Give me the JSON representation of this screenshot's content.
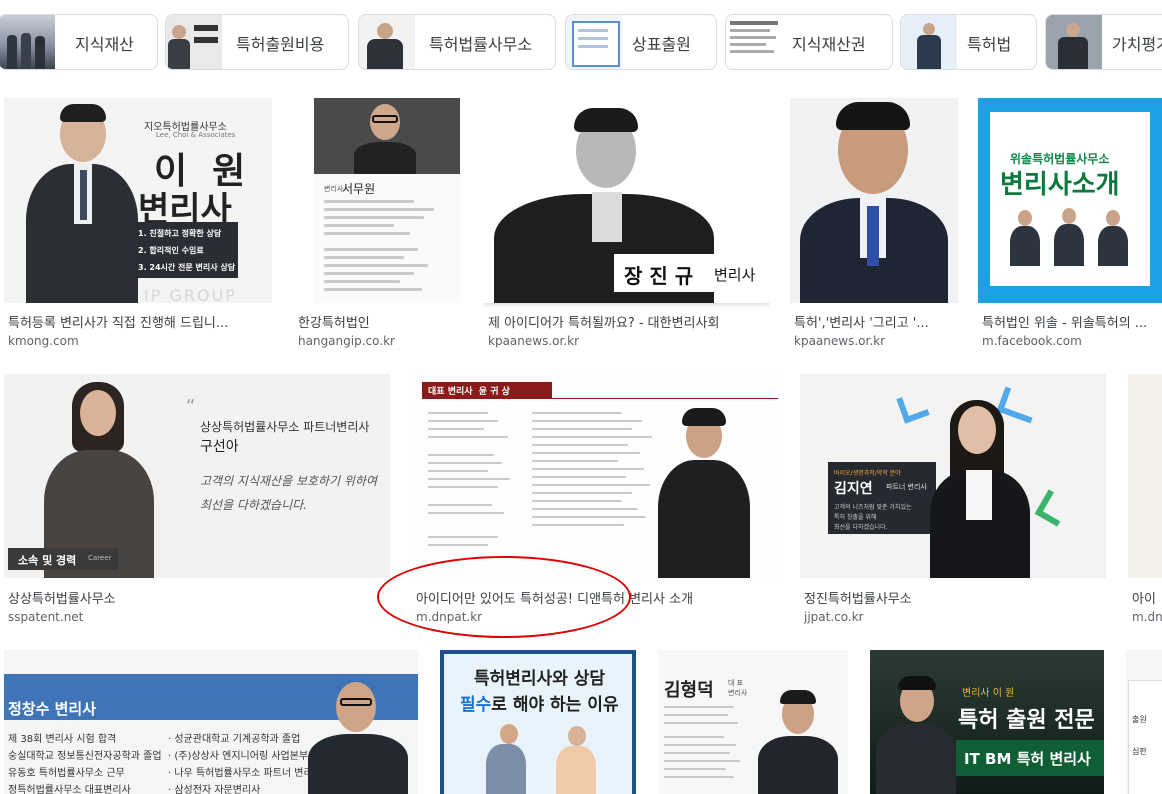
{
  "chips": [
    {
      "label": "지식재산"
    },
    {
      "label": "특허출원비용"
    },
    {
      "label": "특허법률사무소"
    },
    {
      "label": "상표출원"
    },
    {
      "label": "지식재산권"
    },
    {
      "label": "특허법"
    },
    {
      "label": "가치평가"
    }
  ],
  "row1": [
    {
      "title": "특허등록 변리사가 직접 진행해 드립니...",
      "source": "kmong.com",
      "img": {
        "logo": "지오특허법률사무소",
        "logo_sub": "Lee, Choi & Associates",
        "big1": "이  원",
        "big2": "변리사",
        "bullets": [
          "1. 친절하고 정확한 상담",
          "2. 합리적인 수임료",
          "3. 24시간 전문 변리사 상담"
        ],
        "footer": "IP GROUP"
      }
    },
    {
      "title": "한강특허법인",
      "source": "hangangip.co.kr",
      "img": {
        "role": "변리사",
        "name": "서무원"
      }
    },
    {
      "title": "제 아이디어가 특허될까요? - 대한변리사회",
      "source": "kpaanews.or.kr",
      "img": {
        "caption_name": "장 진 규",
        "caption_role": "변리사"
      }
    },
    {
      "title": "특허','변리사 '그리고 '...",
      "source": "kpaanews.or.kr",
      "img": {}
    },
    {
      "title": "특허법인 위솔 - 위솔특허의 ...",
      "source": "m.facebook.com",
      "img": {
        "top": "위솔특허법률사무소",
        "main": "변리사소개"
      }
    }
  ],
  "row2": [
    {
      "title": "상상특허법률사무소",
      "source": "sspatent.net",
      "img": {
        "office": "상상특허법률사무소 파트너변리사",
        "name": "구선아",
        "hand1": "고객의 지식재산을 보호하기 위하여",
        "hand2": "최선을 다하겠습니다.",
        "tag": "소속 및 경력",
        "tag_en": "Career"
      }
    },
    {
      "title": "아이디어만 있어도 특허성공! 디앤특허 변리사 소개",
      "source": "m.dnpat.kr",
      "img": {
        "header": "대표 변리사  윤 귀 상"
      }
    },
    {
      "title": "정진특허법률사무소",
      "source": "jjpat.co.kr",
      "img": {
        "small": "바이오/생명과학/약학 분야",
        "name": "김지연",
        "role": "파트너 변리사",
        "desc1": "고객의 니즈처럼 맞춘 가치있는",
        "desc2": "특허 창출을 위해",
        "desc3": "최선을 다하겠습니다."
      }
    },
    {
      "title": "아이",
      "source": "m.dn",
      "img": {}
    }
  ],
  "row3": [
    {
      "img": {
        "name": "정창수 변리사",
        "left": [
          "제 38회 변리사 시험 합격",
          "숭실대학교 정보통신전자공학과 졸업",
          "유동호 특허법률사무소 근무",
          "정특허법률사무소 대표변리사"
        ],
        "right": [
          "· 성균관대학교 기계공학과 졸업",
          "· (주)상상사 엔지니어링 사업본부 근무",
          "· 나우 특허법률사무소 파트너 변리사",
          "· 삼성전자 자문변리사"
        ]
      }
    },
    {
      "img": {
        "line1": "특허변리사와 상담",
        "line2a": "필수",
        "line2b": "로 해야 하는 이유"
      }
    },
    {
      "img": {
        "name": "김형덕",
        "tag": "대 표 변리사"
      }
    },
    {
      "img": {
        "top": "변리사 이 원",
        "main": "특허 출원 전문",
        "sub": "IT BM 특허 변리사"
      }
    },
    {
      "img": {
        "t1": "출원",
        "t2": "심판"
      }
    }
  ]
}
